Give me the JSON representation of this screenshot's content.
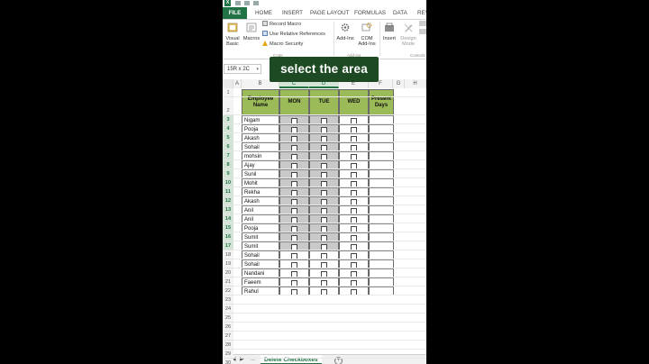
{
  "ribbon_tabs": [
    "FILE",
    "HOME",
    "INSERT",
    "PAGE LAYOUT",
    "FORMULAS",
    "DATA",
    "REV"
  ],
  "ribbon": {
    "visual_basic": "Visual Basic",
    "macros": "Macros",
    "record_macro": "Record Macro",
    "use_relative": "Use Relative References",
    "macro_security": "Macro Security",
    "group_code": "Code",
    "addins": "Add-Ins",
    "com_addins": "COM Add-Ins",
    "group_addins": "Add-ins",
    "insert": "Insert",
    "design_mode": "Design Mode",
    "group_controls": "Controls"
  },
  "name_box": "15R x 2C",
  "overlay_text": "select the area",
  "columns": [
    "A",
    "B",
    "C",
    "D",
    "E",
    "F",
    "G",
    "H"
  ],
  "rows": [
    "1",
    "2",
    "3",
    "4",
    "5",
    "6",
    "7",
    "8",
    "9",
    "10",
    "11",
    "12",
    "13",
    "14",
    "15",
    "16",
    "17",
    "18",
    "19",
    "20",
    "21",
    "22",
    "23",
    "24",
    "25",
    "26",
    "27",
    "28",
    "29",
    "30"
  ],
  "table": {
    "headers": [
      "Employee Name",
      "MON",
      "TUE",
      "WED",
      "Present Days"
    ],
    "names": [
      "Nigam",
      "Pooja",
      "Akash",
      "Sohail",
      "mohsin",
      "Ajay",
      "Sunil",
      "Mohit",
      "Rekha",
      "Akash",
      "Anil",
      "Anil",
      "Pooja",
      "Sumit",
      "Sumit",
      "Sohail",
      "Sohail",
      "Nandani",
      "Faeem",
      "Rahul"
    ]
  },
  "sheet_tab": "Delete Checkboxes",
  "colors": {
    "header_green": "#9bbb59",
    "excel_green": "#217346",
    "overlay_bg": "#1d4a22",
    "selection_gray": "#c9c9c9"
  }
}
